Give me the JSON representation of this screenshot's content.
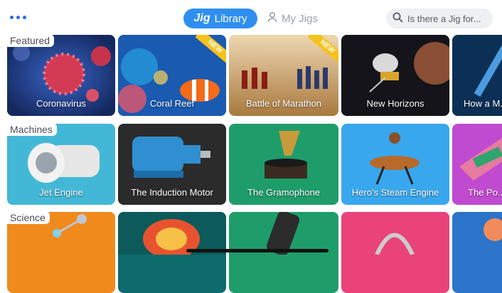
{
  "topbar": {
    "menu_icon": "more-dots-icon",
    "tab_library_logo": "Jig",
    "tab_library_label": "Library",
    "tab_myjigs_label": "My Jigs",
    "search_placeholder": "Is there a Jig for..."
  },
  "sections": [
    {
      "title": "Featured",
      "items": [
        {
          "label": "Coronavirus",
          "color": "#1f3f88"
        },
        {
          "label": "Coral Reef",
          "color": "#1a5ab0",
          "badge": "NEW"
        },
        {
          "label": "Battle of Marathon",
          "color": "#b88a55",
          "badge": "NEW"
        },
        {
          "label": "New Horizons",
          "color": "#1b1b22"
        },
        {
          "label": "How a M... W...",
          "color": "#0d3b66"
        }
      ]
    },
    {
      "title": "Machines",
      "items": [
        {
          "label": "Jet Engine",
          "color": "#43b8d6"
        },
        {
          "label": "The Induction Motor",
          "color": "#2b2b2b"
        },
        {
          "label": "The Gramophone",
          "color": "#1e9d6b"
        },
        {
          "label": "Hero's Steam Engine",
          "color": "#38a7ee"
        },
        {
          "label": "The Po...",
          "color": "#c04bd1"
        }
      ]
    },
    {
      "title": "Science",
      "items": [
        {
          "label": "",
          "color": "#f08a1c"
        },
        {
          "label": "",
          "color": "#0e6b6b"
        },
        {
          "label": "",
          "color": "#1e9d6b"
        },
        {
          "label": "",
          "color": "#e9437a"
        },
        {
          "label": "",
          "color": "#2b74c9"
        }
      ]
    }
  ]
}
